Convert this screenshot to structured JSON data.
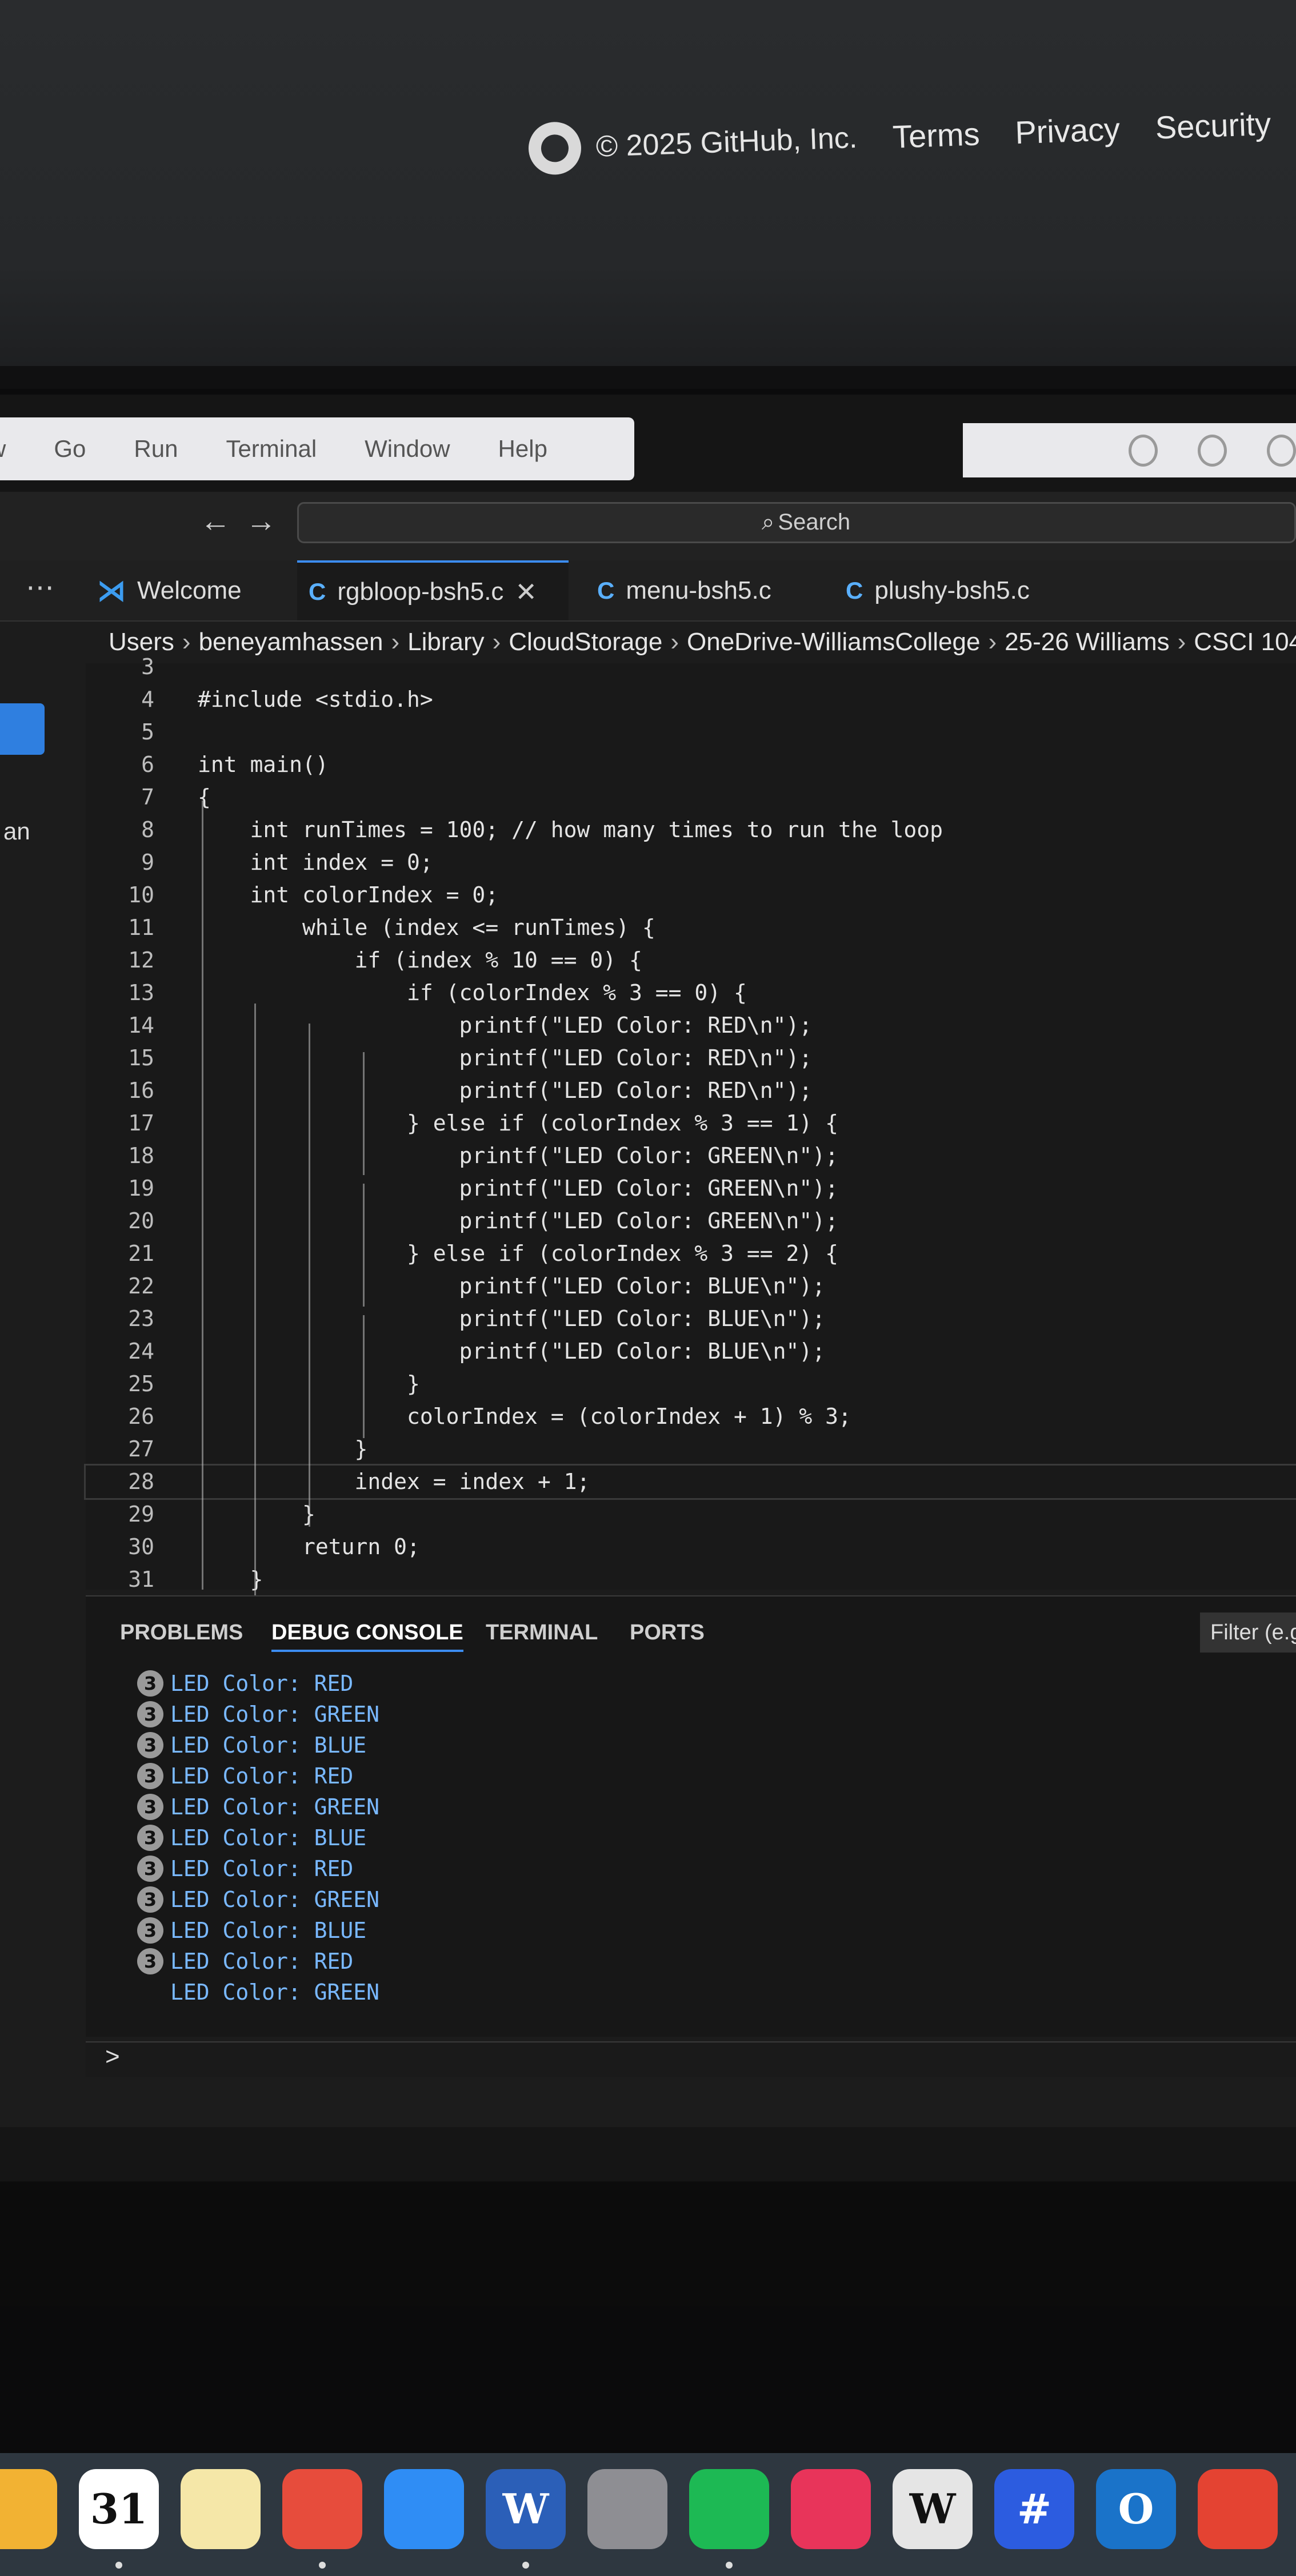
{
  "github_footer": {
    "copyright": "© 2025 GitHub, Inc.",
    "links": [
      "Terms",
      "Privacy",
      "Security",
      "S"
    ]
  },
  "menubar": {
    "items": [
      "w",
      "Go",
      "Run",
      "Terminal",
      "Window",
      "Help"
    ]
  },
  "titlebar": {
    "back": "←",
    "forward": "→",
    "search_label": "Search"
  },
  "tabs": [
    {
      "label": "Welcome",
      "icon": "vscode-icon"
    },
    {
      "label": "rgbloop-bsh5.c",
      "icon": "c-file-icon",
      "active": true
    },
    {
      "label": "menu-bsh5.c",
      "icon": "c-file-icon"
    },
    {
      "label": "plushy-bsh5.c",
      "icon": "c-file-icon"
    }
  ],
  "breadcrumb": [
    "Users",
    "beneyamhassen",
    "Library",
    "CloudStorage",
    "OneDrive-WilliamsCollege",
    "25-26 Williams",
    "CSCI 104"
  ],
  "sidebar_fragment": "an",
  "code_lines": [
    {
      "n": "3",
      "text": ""
    },
    {
      "n": "4",
      "text": "#include <stdio.h>"
    },
    {
      "n": "5",
      "text": ""
    },
    {
      "n": "6",
      "text": "int main()"
    },
    {
      "n": "7",
      "text": "{"
    },
    {
      "n": "8",
      "text": "    int runTimes = 100; // how many times to run the loop"
    },
    {
      "n": "9",
      "text": "    int index = 0;"
    },
    {
      "n": "10",
      "text": "    int colorIndex = 0;"
    },
    {
      "n": "11",
      "text": "        while (index <= runTimes) {"
    },
    {
      "n": "12",
      "text": "            if (index % 10 == 0) {"
    },
    {
      "n": "13",
      "text": "                if (colorIndex % 3 == 0) {"
    },
    {
      "n": "14",
      "text": "                    printf(\"LED Color: RED\\n\");"
    },
    {
      "n": "15",
      "text": "                    printf(\"LED Color: RED\\n\");"
    },
    {
      "n": "16",
      "text": "                    printf(\"LED Color: RED\\n\");"
    },
    {
      "n": "17",
      "text": "                } else if (colorIndex % 3 == 1) {"
    },
    {
      "n": "18",
      "text": "                    printf(\"LED Color: GREEN\\n\");"
    },
    {
      "n": "19",
      "text": "                    printf(\"LED Color: GREEN\\n\");"
    },
    {
      "n": "20",
      "text": "                    printf(\"LED Color: GREEN\\n\");"
    },
    {
      "n": "21",
      "text": "                } else if (colorIndex % 3 == 2) {"
    },
    {
      "n": "22",
      "text": "                    printf(\"LED Color: BLUE\\n\");"
    },
    {
      "n": "23",
      "text": "                    printf(\"LED Color: BLUE\\n\");"
    },
    {
      "n": "24",
      "text": "                    printf(\"LED Color: BLUE\\n\");"
    },
    {
      "n": "25",
      "text": "                }"
    },
    {
      "n": "26",
      "text": "                colorIndex = (colorIndex + 1) % 3;"
    },
    {
      "n": "27",
      "text": "            }"
    },
    {
      "n": "28",
      "text": "            index = index + 1;"
    },
    {
      "n": "29",
      "text": "        }"
    },
    {
      "n": "30",
      "text": "        return 0;"
    },
    {
      "n": "31",
      "text": "    }"
    }
  ],
  "panel": {
    "tabs": [
      "PROBLEMS",
      "DEBUG CONSOLE",
      "TERMINAL",
      "PORTS"
    ],
    "active_tab": "DEBUG CONSOLE",
    "filter_placeholder": "Filter (e.g."
  },
  "console_output": [
    {
      "count": "3",
      "text": "LED Color: RED"
    },
    {
      "count": "3",
      "text": "LED Color: GREEN"
    },
    {
      "count": "3",
      "text": "LED Color: BLUE"
    },
    {
      "count": "3",
      "text": "LED Color: RED"
    },
    {
      "count": "3",
      "text": "LED Color: GREEN"
    },
    {
      "count": "3",
      "text": "LED Color: BLUE"
    },
    {
      "count": "3",
      "text": "LED Color: RED"
    },
    {
      "count": "3",
      "text": "LED Color: GREEN"
    },
    {
      "count": "3",
      "text": "LED Color: BLUE"
    },
    {
      "count": "3",
      "text": "LED Color: RED"
    },
    {
      "count": "",
      "text": "LED Color: GREEN"
    }
  ],
  "console_prompt": ">",
  "dock": [
    {
      "name": "photos-icon",
      "color": "#f2b233",
      "dot": false
    },
    {
      "name": "calendar-icon",
      "color": "#ffffff",
      "label": "31",
      "dot": true
    },
    {
      "name": "notes-icon",
      "color": "#f5e7a8",
      "dot": false
    },
    {
      "name": "chrome-icon",
      "color": "#e74c3c",
      "dot": true
    },
    {
      "name": "app-store-icon",
      "color": "#2f8df5",
      "dot": false
    },
    {
      "name": "word-icon",
      "color": "#2b5fb8",
      "label": "W",
      "dot": true
    },
    {
      "name": "system-settings-icon",
      "color": "#8e8e93",
      "dot": false
    },
    {
      "name": "spotify-icon",
      "color": "#1db954",
      "dot": true
    },
    {
      "name": "creative-cloud-icon",
      "color": "#e8345a",
      "dot": false
    },
    {
      "name": "wikipedia-icon",
      "color": "#e5e5e5",
      "label": "W",
      "dot": false
    },
    {
      "name": "teams-icon",
      "color": "#2c5ce0",
      "label": "#",
      "dot": false
    },
    {
      "name": "outlook-icon",
      "color": "#1a73c9",
      "label": "O",
      "dot": false
    },
    {
      "name": "todoist-icon",
      "color": "#e44332",
      "dot": false
    }
  ],
  "colors": {
    "accent": "#3c8cf0",
    "console_text": "#79b8ff",
    "keyword": "#5aa9ff",
    "string": "#e8c79a"
  }
}
